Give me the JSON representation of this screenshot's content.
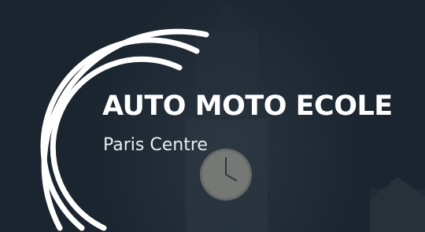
{
  "brand": {
    "name": "AUTO MOTO ECOLE",
    "location": "Paris Centre"
  },
  "background": {
    "icon": "clock-tower-icon"
  },
  "colors": {
    "background": "#1c2631",
    "text": "#ffffff",
    "arcs": "#ffffff"
  }
}
